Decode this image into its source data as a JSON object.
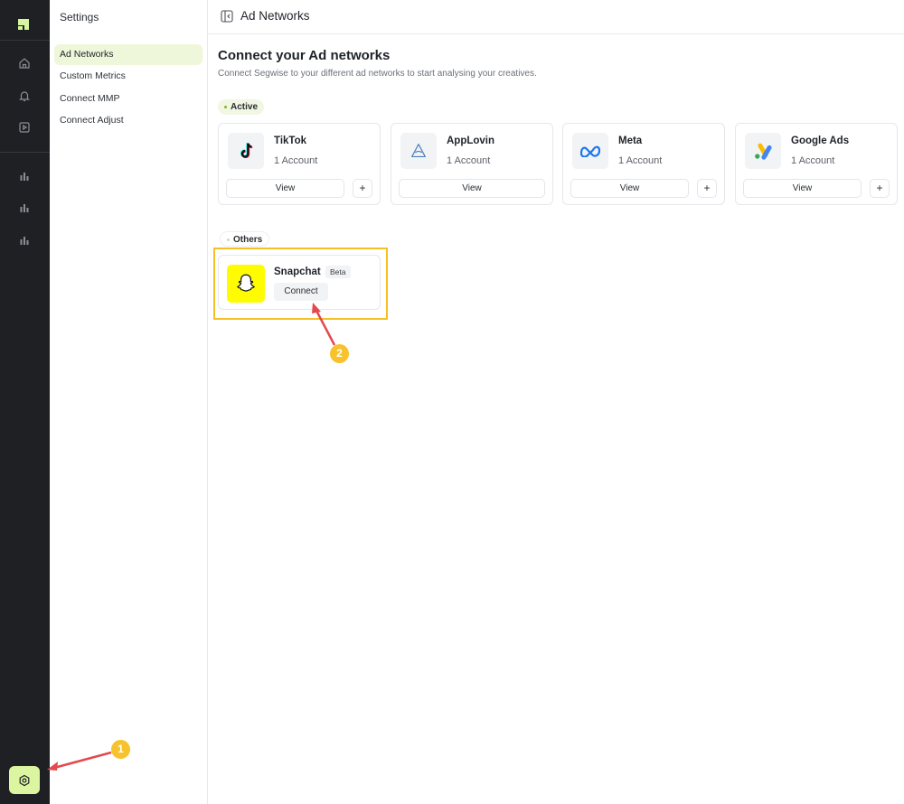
{
  "sidebar": {
    "title": "Settings",
    "items": [
      {
        "label": "Ad Networks",
        "active": true
      },
      {
        "label": "Custom Metrics",
        "active": false
      },
      {
        "label": "Connect MMP",
        "active": false
      },
      {
        "label": "Connect Adjust",
        "active": false
      }
    ]
  },
  "rail": {
    "icons": [
      "logo-icon",
      "home-icon",
      "bell-icon",
      "play-icon",
      "bar-chart-icon",
      "bar-chart-icon",
      "bar-chart-icon"
    ],
    "settings_icon": "gear-icon"
  },
  "header": {
    "title": "Ad Networks",
    "toggle_icon": "sidebar-toggle-icon"
  },
  "main": {
    "title": "Connect your Ad networks",
    "subtitle": "Connect Segwise to your different ad networks to start analysing your creatives.",
    "active_label": "Active",
    "others_label": "Others"
  },
  "networks": [
    {
      "name": "TikTok",
      "accounts": "1 Account",
      "view": "View",
      "add": "+",
      "icon": "tiktok-icon"
    },
    {
      "name": "AppLovin",
      "accounts": "1 Account",
      "view": "View",
      "icon": "applovin-icon"
    },
    {
      "name": "Meta",
      "accounts": "1 Account",
      "view": "View",
      "add": "+",
      "icon": "meta-icon"
    },
    {
      "name": "Google Ads",
      "accounts": "1 Account",
      "view": "View",
      "add": "+",
      "icon": "google-ads-icon"
    }
  ],
  "others": [
    {
      "name": "Snapchat",
      "badge": "Beta",
      "action": "Connect",
      "icon": "snapchat-icon"
    }
  ],
  "annotations": [
    {
      "label": "1"
    },
    {
      "label": "2"
    }
  ],
  "colors": {
    "rail_bg": "#1e2024",
    "accent_lime": "#dcf5a0",
    "highlight_yellow": "#f5c023",
    "annotation_arrow": "#e5484d",
    "snapchat_yellow": "#fffc00"
  }
}
